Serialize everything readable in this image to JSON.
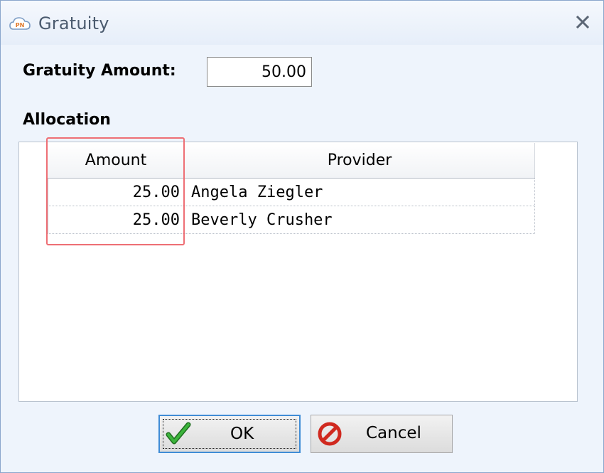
{
  "window": {
    "title": "Gratuity",
    "app_icon": "pn-cloud-icon",
    "close_icon": "close-icon"
  },
  "gratuity": {
    "label": "Gratuity Amount:",
    "value": "50.00"
  },
  "allocation": {
    "label": "Allocation",
    "columns": [
      "Amount",
      "Provider"
    ],
    "rows": [
      {
        "amount": "25.00",
        "provider": "Angela Ziegler"
      },
      {
        "amount": "25.00",
        "provider": "Beverly Crusher"
      }
    ]
  },
  "buttons": {
    "ok_label": "OK",
    "ok_icon": "checkmark-icon",
    "cancel_label": "Cancel",
    "cancel_icon": "cancel-icon"
  },
  "colors": {
    "highlight": "#ee6f75",
    "ok_focus": "#3f8cd6",
    "check_green": "#2e9e2e",
    "cancel_red": "#d0291f"
  }
}
